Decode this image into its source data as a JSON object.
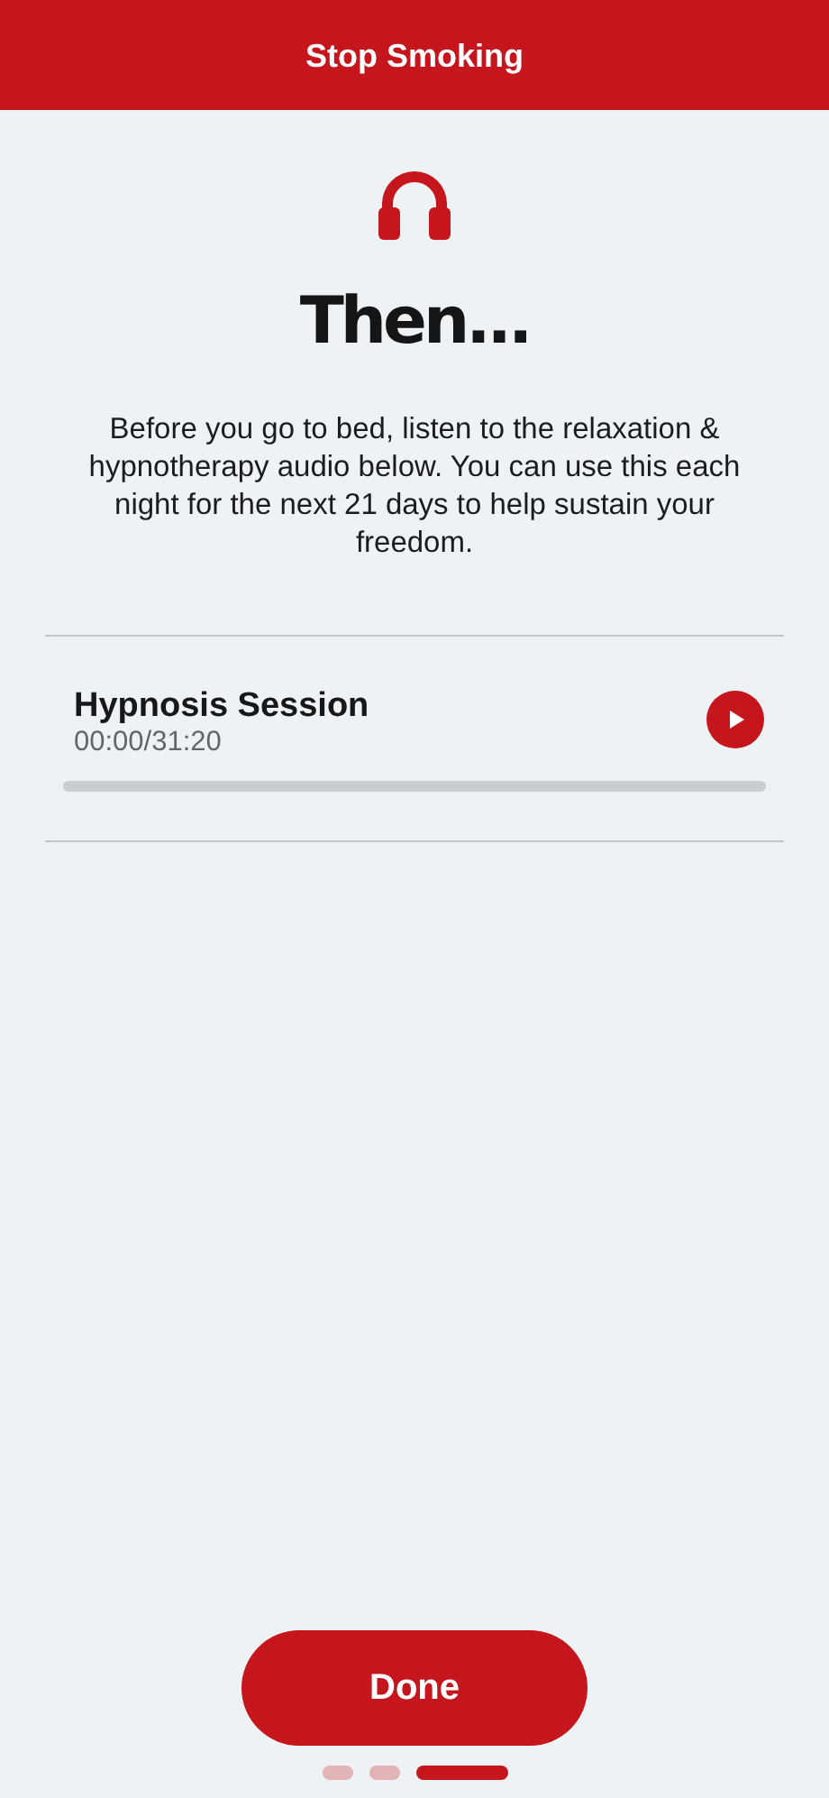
{
  "header": {
    "title": "Stop Smoking"
  },
  "heading": "Then...",
  "description": "Before you go to bed, listen to the relaxation & hypnotherapy audio below. You can use this each night for the next 21 days to help sustain your freedom.",
  "audio": {
    "title": "Hypnosis Session",
    "time": "00:00/31:20",
    "level": 0,
    "playing": false
  },
  "done_button": "Done",
  "page_dots": [
    {
      "selected": false
    },
    {
      "selected": false
    },
    {
      "selected": true
    }
  ]
}
